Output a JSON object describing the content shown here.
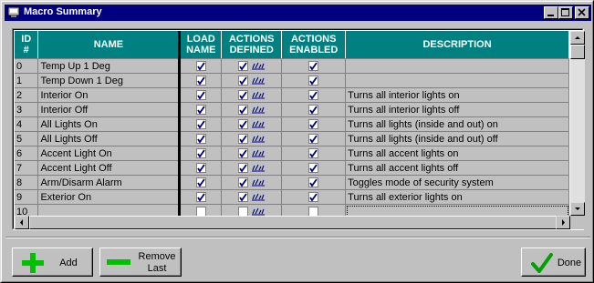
{
  "window": {
    "title": "Macro Summary"
  },
  "columns": {
    "id": [
      "ID",
      "#"
    ],
    "name": "NAME",
    "load_name": [
      "LOAD",
      "NAME"
    ],
    "actions_defined": [
      "ACTIONS",
      "DEFINED"
    ],
    "actions_enabled": [
      "ACTIONS",
      "ENABLED"
    ],
    "description": "DESCRIPTION"
  },
  "rows": [
    {
      "id": "0",
      "name": "Temp Up 1 Deg",
      "load_name": true,
      "actions_defined": true,
      "actions_enabled": true,
      "description": ""
    },
    {
      "id": "1",
      "name": "Temp Down 1 Deg",
      "load_name": true,
      "actions_defined": true,
      "actions_enabled": true,
      "description": ""
    },
    {
      "id": "2",
      "name": "Interior On",
      "load_name": true,
      "actions_defined": true,
      "actions_enabled": true,
      "description": "Turns all interior lights on"
    },
    {
      "id": "3",
      "name": "Interior Off",
      "load_name": true,
      "actions_defined": true,
      "actions_enabled": true,
      "description": "Turns all interior lights off"
    },
    {
      "id": "4",
      "name": "All Lights On",
      "load_name": true,
      "actions_defined": true,
      "actions_enabled": true,
      "description": "Turns all lights (inside and out) on"
    },
    {
      "id": "5",
      "name": "All Lights Off",
      "load_name": true,
      "actions_defined": true,
      "actions_enabled": true,
      "description": "Turns all lights (inside and out) off"
    },
    {
      "id": "6",
      "name": "Accent Light On",
      "load_name": true,
      "actions_defined": true,
      "actions_enabled": true,
      "description": "Turns all accent lights on"
    },
    {
      "id": "7",
      "name": "Accent Light Off",
      "load_name": true,
      "actions_defined": true,
      "actions_enabled": true,
      "description": "Turns all accent lights off"
    },
    {
      "id": "8",
      "name": "Arm/Disarm Alarm",
      "load_name": true,
      "actions_defined": true,
      "actions_enabled": true,
      "description": "Toggles mode of security system"
    },
    {
      "id": "9",
      "name": "Exterior On",
      "load_name": true,
      "actions_defined": true,
      "actions_enabled": true,
      "description": "Turns all exterior lights on"
    },
    {
      "id": "10",
      "name": "",
      "load_name": false,
      "actions_defined": false,
      "actions_enabled": false,
      "description": ""
    }
  ],
  "buttons": {
    "add": "Add",
    "remove_last": [
      "Remove",
      "Last"
    ],
    "done": "Done"
  },
  "icons": {
    "add": "plus-icon",
    "remove": "minus-icon",
    "done": "checkmark-icon",
    "actions": "actions-edit-icon"
  },
  "colors": {
    "title_bar": "#000080",
    "header": "#008080",
    "face": "#c0c0c0",
    "check": "#000080",
    "add_green": "#00c000"
  }
}
